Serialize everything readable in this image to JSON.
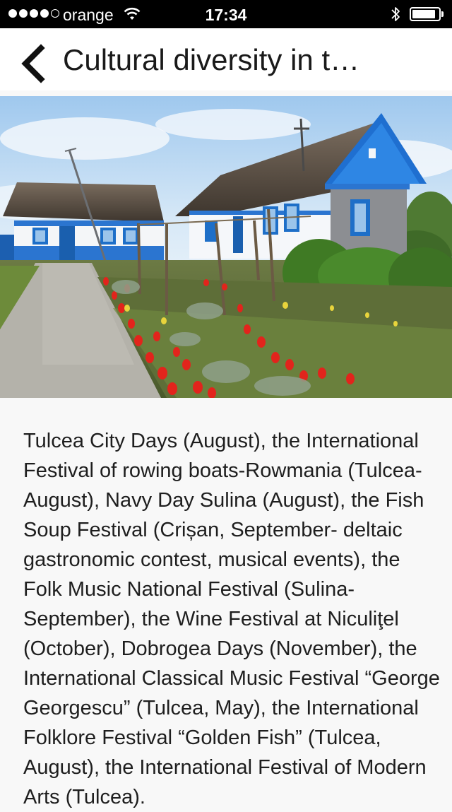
{
  "status_bar": {
    "carrier": "orange",
    "time": "17:34",
    "signal_bars_filled": 4,
    "signal_bars_total": 5,
    "battery_level": 0.9
  },
  "nav": {
    "back_icon": "chevron-left-icon",
    "title": "Cultural diversity in t…"
  },
  "article": {
    "body": "Tulcea City Days (August), the International Festival of rowing boats-Rowmania (Tulcea- August), Navy Day Sulina (August), the Fish Soup Festival (Crișan, September- deltaic gastronomic contest, musical events), the Folk Music National Festival (Sulina-September), the Wine Festival at Niculiţel (October), Dobrogea Days (November), the International Classical Music Festival “George Georgescu” (Tulcea, May), the International Folklore Festival “Golden Fish” (Tulcea, August), the International Festival of Modern Arts (Tulcea)."
  },
  "colors": {
    "status_bar_bg": "#000000",
    "nav_bg": "#ffffff",
    "page_bg": "#f8f8f8",
    "text": "#1e1e1e",
    "house_blue": "#1e6fc8"
  }
}
